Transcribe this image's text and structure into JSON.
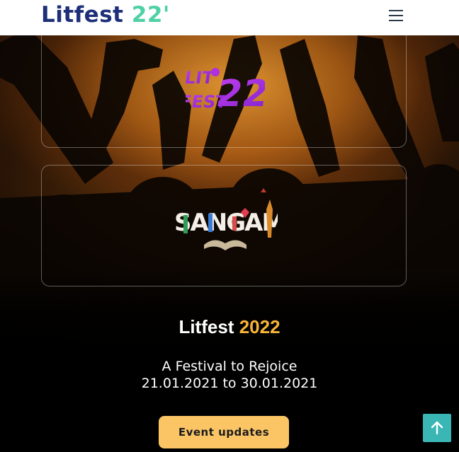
{
  "header": {
    "brand_main": "Litfest",
    "brand_accent": "22'",
    "menu_icon": "hamburger-menu-icon"
  },
  "logos": {
    "litfest_logo_text": "LIT FEST 22'",
    "sangamam_logo_text": "SANGAMAM"
  },
  "hero": {
    "title_main": "Litfest",
    "title_year": "2022",
    "tagline": "A Festival to Rejoice",
    "dates": "21.01.2021 to 30.01.2021",
    "cta_label": "Event updates"
  },
  "scroll_top": {
    "icon": "arrow-up-icon"
  },
  "colors": {
    "brand_navy": "#1e2f7a",
    "brand_mint": "#4fd1a5",
    "year_gold": "#f7b538",
    "button_yellow": "#fbc566",
    "scroll_teal": "#3ab7b5",
    "logo_purple": "#a23be0"
  }
}
